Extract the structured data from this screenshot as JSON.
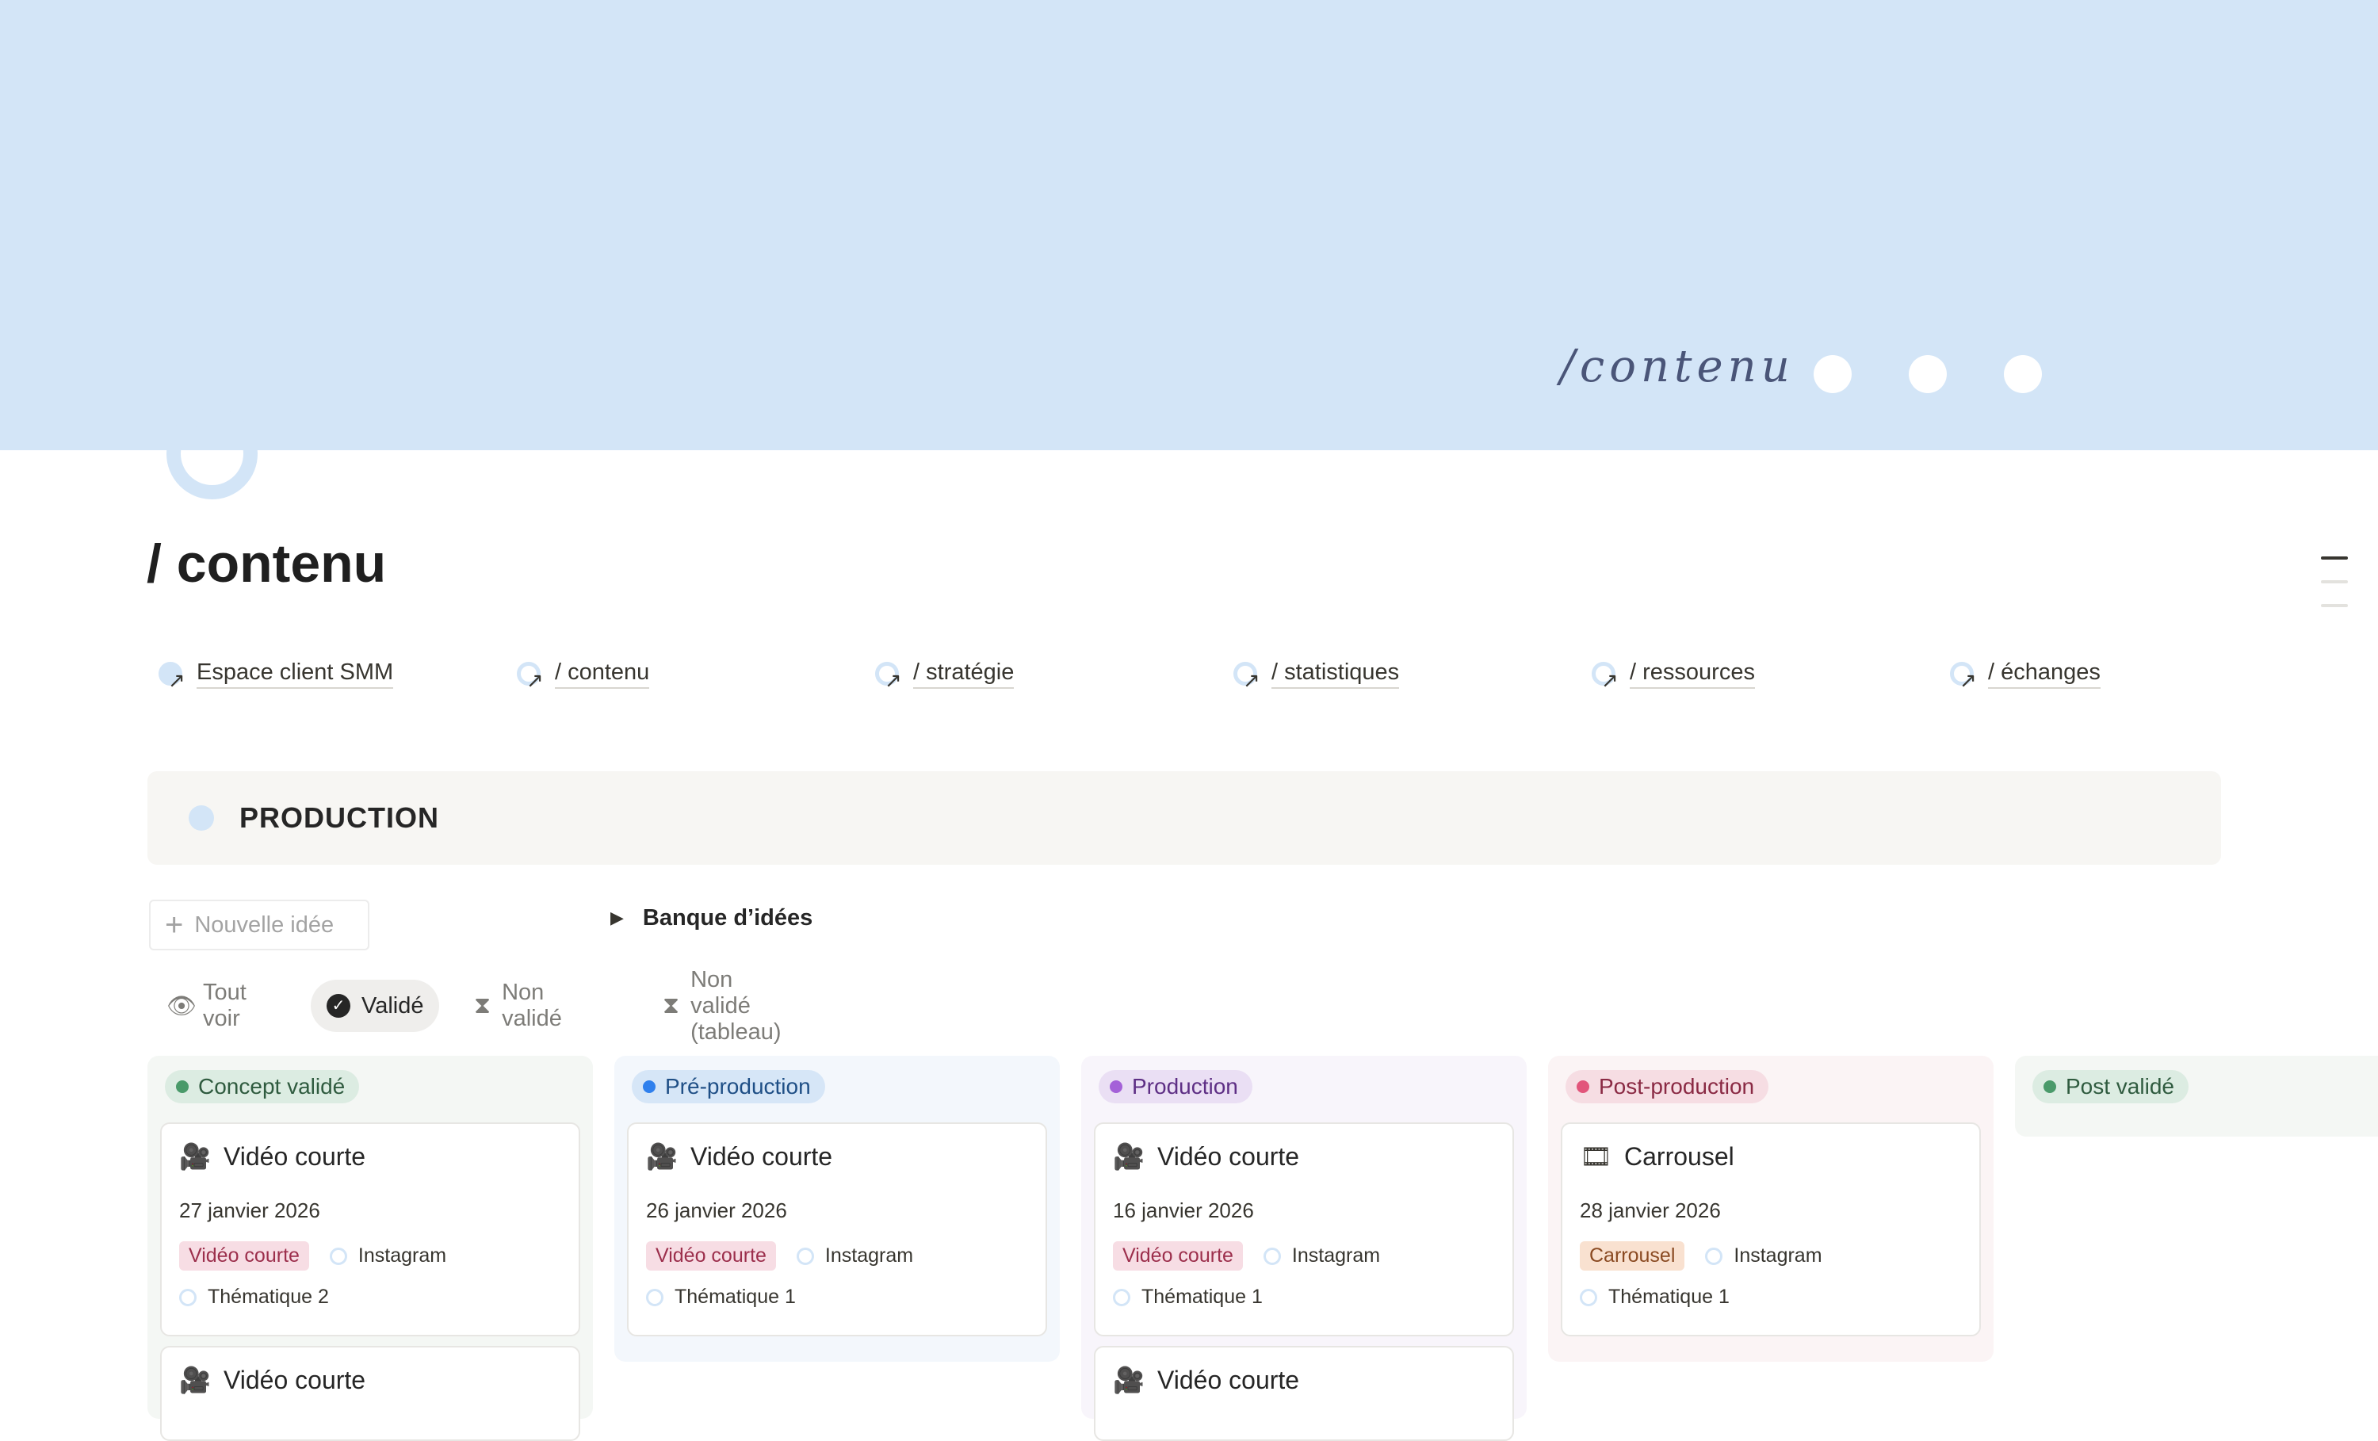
{
  "cover": {
    "word": "/contenu",
    "dots": [
      "dot",
      "dot",
      "dot"
    ]
  },
  "page": {
    "title": "/ contenu"
  },
  "links": [
    {
      "label": "Espace client SMM"
    },
    {
      "label": "/ contenu"
    },
    {
      "label": "/ stratégie"
    },
    {
      "label": "/ statistiques"
    },
    {
      "label": "/ ressources"
    },
    {
      "label": "/ échanges"
    }
  ],
  "callout": {
    "title": "PRODUCTION"
  },
  "new_button": {
    "plus": "+",
    "label": "Nouvelle idée"
  },
  "toggle": {
    "arrow": "▶",
    "label": "Banque d’idées"
  },
  "views": [
    {
      "icon": "eye-icon",
      "label": "Tout voir",
      "active": false
    },
    {
      "icon": "check-circle-icon",
      "label": "Validé",
      "active": true
    },
    {
      "icon": "hourglass-icon",
      "label": "Non validé",
      "active": false
    },
    {
      "icon": "hourglass-icon",
      "label": "Non validé (tableau)",
      "active": false
    }
  ],
  "colors": {
    "cover": "#d3e5f7",
    "concept": "#4a9a6a",
    "preprod": "#2f80ed",
    "production": "#a461d8",
    "postprod": "#e2557b",
    "postvalide": "#4a9a6a"
  },
  "board": {
    "columns": [
      {
        "name": "Concept validé",
        "cards": [
          {
            "icon": "video-camera-icon",
            "title": "Vidéo courte",
            "date": "27 janvier 2026",
            "tag": "Vidéo courte",
            "platform": "Instagram",
            "theme": "Thématique 2"
          },
          {
            "icon": "video-camera-icon",
            "title": "Vidéo courte"
          }
        ]
      },
      {
        "name": "Pré-production",
        "cards": [
          {
            "icon": "video-camera-icon",
            "title": "Vidéo courte",
            "date": "26 janvier 2026",
            "tag": "Vidéo courte",
            "platform": "Instagram",
            "theme": "Thématique 1"
          }
        ]
      },
      {
        "name": "Production",
        "cards": [
          {
            "icon": "video-camera-icon",
            "title": "Vidéo courte",
            "date": "16 janvier 2026",
            "tag": "Vidéo courte",
            "platform": "Instagram",
            "theme": "Thématique 1"
          },
          {
            "icon": "video-camera-icon",
            "title": "Vidéo courte"
          }
        ]
      },
      {
        "name": "Post-production",
        "cards": [
          {
            "icon": "film-frames-icon",
            "title": "Carrousel",
            "date": "28 janvier 2026",
            "tag": "Carrousel",
            "platform": "Instagram",
            "theme": "Thématique 1"
          }
        ]
      },
      {
        "name": "Post validé",
        "cards": []
      }
    ]
  }
}
